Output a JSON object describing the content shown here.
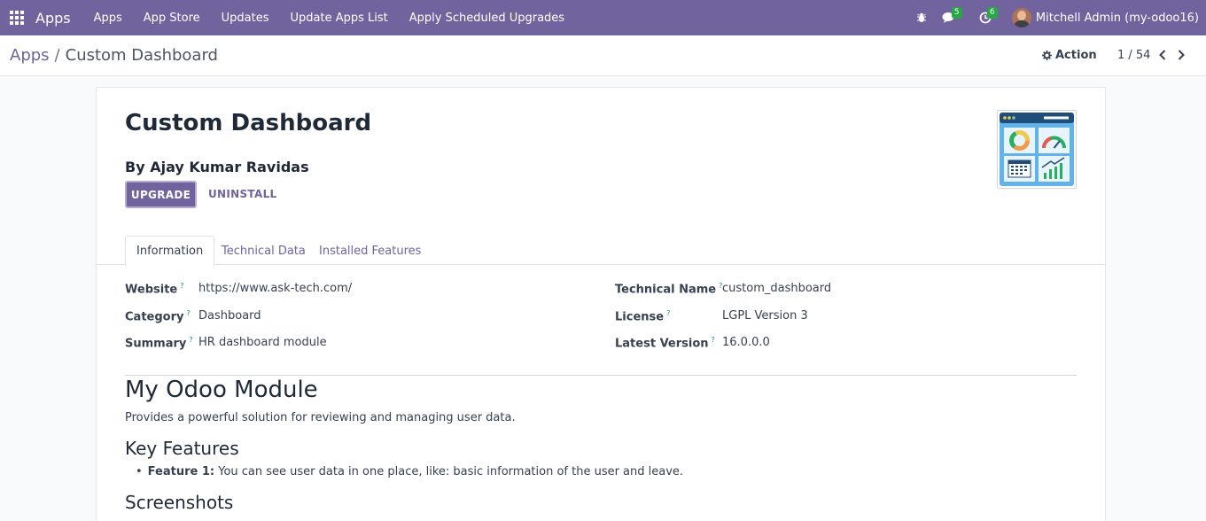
{
  "navbar": {
    "brand": "Apps",
    "menu": [
      "Apps",
      "App Store",
      "Updates",
      "Update Apps List",
      "Apply Scheduled Upgrades"
    ],
    "messages_badge": "5",
    "activities_badge": "6",
    "user": "Mitchell Admin (my-odoo16)"
  },
  "control_panel": {
    "breadcrumb_parent": "Apps",
    "breadcrumb_separator": "/",
    "breadcrumb_current": "Custom Dashboard",
    "action_label": "Action",
    "pager": "1 / 54"
  },
  "module": {
    "title": "Custom Dashboard",
    "author": "By Ajay Kumar Ravidas",
    "upgrade_label": "UPGRADE",
    "uninstall_label": "UNINSTALL"
  },
  "tabs": [
    "Information",
    "Technical Data",
    "Installed Features"
  ],
  "info": {
    "website_label": "Website",
    "website": "https://www.ask-tech.com/",
    "category_label": "Category",
    "category": "Dashboard",
    "summary_label": "Summary",
    "summary": "HR dashboard module",
    "technical_name_label": "Technical Name",
    "technical_name": "custom_dashboard",
    "license_label": "License",
    "license": "LGPL Version 3",
    "latest_version_label": "Latest Version",
    "latest_version": "16.0.0.0",
    "help_mark": "?"
  },
  "description": {
    "heading": "My Odoo Module",
    "intro": "Provides a powerful solution for reviewing and managing user data.",
    "features_heading": "Key Features",
    "feature1_title": "Feature 1:",
    "feature1_text": " You can see user data in one place, like: basic information of the user and leave.",
    "screenshots_heading": "Screenshots"
  },
  "colors": {
    "navbar": "#71639e",
    "accent": "#71639e",
    "badge": "#28a745"
  }
}
